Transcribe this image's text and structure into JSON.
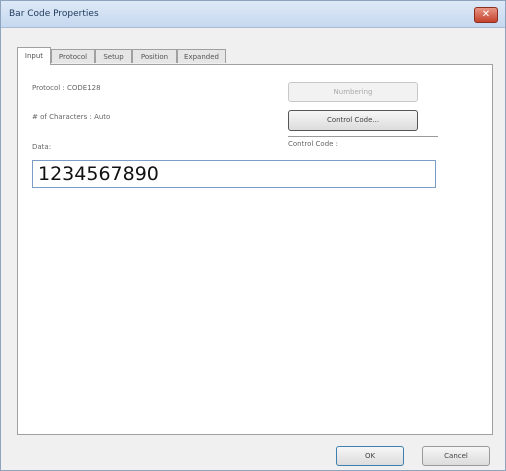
{
  "window": {
    "title": "Bar Code Properties",
    "close_glyph": "✕"
  },
  "tabs": [
    "Input",
    "Protocol",
    "Setup",
    "Position",
    "Expanded"
  ],
  "input_tab": {
    "protocol_label": "Protocol : CODE128",
    "characters_label": "# of Characters : Auto",
    "numbering_button": "Numbering",
    "control_code_button": "Control Code...",
    "control_code_label": "Control Code :",
    "data_label": "Data:",
    "data_value": "1234567890"
  },
  "footer": {
    "ok": "OK",
    "cancel": "Cancel"
  }
}
